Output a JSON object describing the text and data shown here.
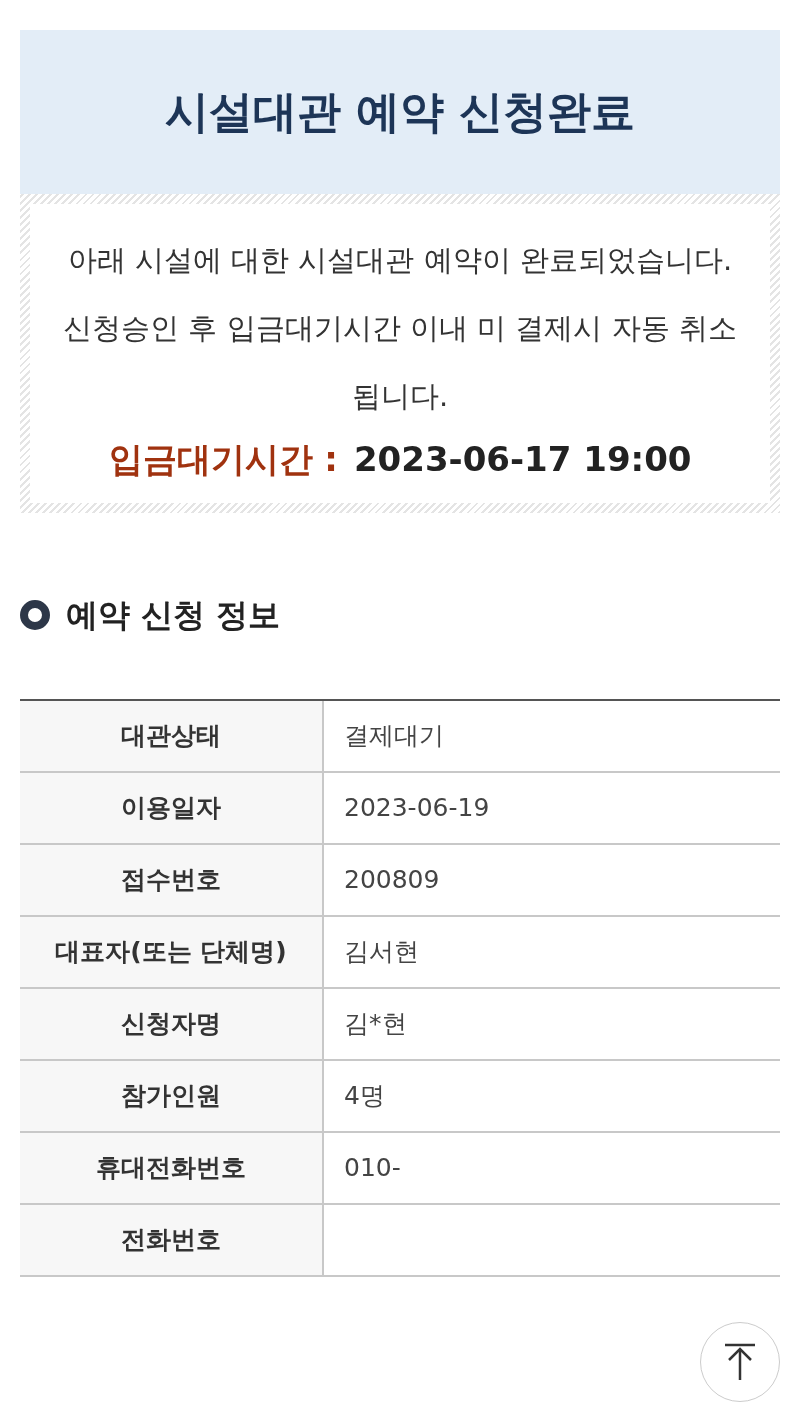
{
  "header": {
    "title": "시설대관 예약 신청완료"
  },
  "notice": {
    "lines": [
      "아래 시설에 대한 시설대관 예약이 완료되었습니다.",
      "신청승인 후 입금대기시간 이내 미 결제시 자동 취소 됩니다."
    ],
    "deadline_label": "입금대기시간 :",
    "deadline_value": "2023-06-17 19:00"
  },
  "section_title": "예약 신청 정보",
  "table": {
    "rows": [
      {
        "label": "대관상태",
        "value": "결제대기"
      },
      {
        "label": "이용일자",
        "value": "2023-06-19"
      },
      {
        "label": "접수번호",
        "value": "200809"
      },
      {
        "label": "대표자(또는 단체명)",
        "value": "김서현"
      },
      {
        "label": "신청자명",
        "value": "김*현"
      },
      {
        "label": "참가인원",
        "value": "4명"
      },
      {
        "label": "휴대전화번호",
        "value": "010-"
      },
      {
        "label": "전화번호"
      }
    ]
  }
}
